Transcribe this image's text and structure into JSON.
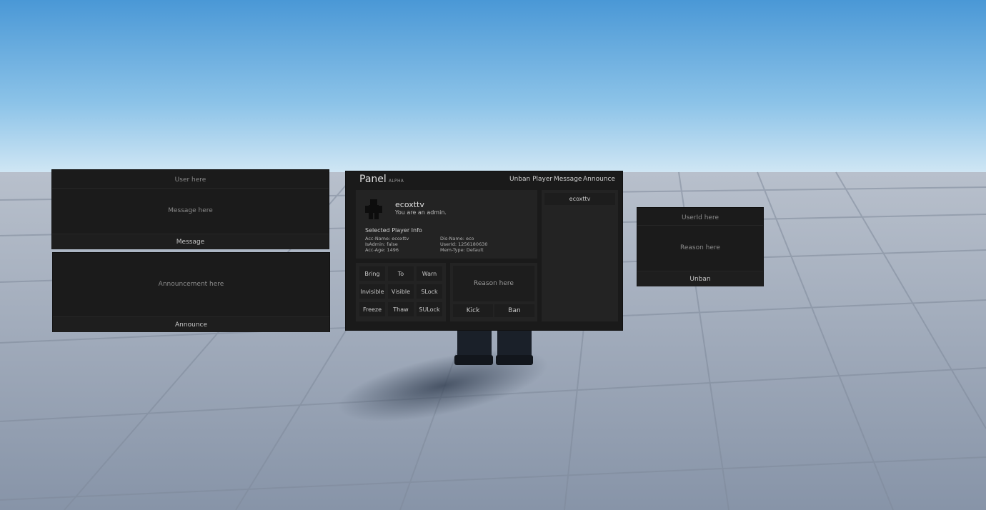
{
  "message_panel": {
    "user_placeholder": "User here",
    "message_placeholder": "Message here",
    "send_label": "Message"
  },
  "announce_panel": {
    "announcement_placeholder": "Announcement here",
    "send_label": "Announce"
  },
  "main_panel": {
    "title": "Panel",
    "badge": "ALPHA",
    "nav": [
      "Unban Player",
      "Message",
      "Announce"
    ],
    "player": {
      "name": "ecoxttv",
      "status": "You are an admin.",
      "info_heading": "Selected Player Info",
      "info_left": [
        "Acc-Name: ecoxttv",
        "IsAdmin: false",
        "Acc-Age: 1496"
      ],
      "info_right": [
        "Dis-Name: eco",
        "UserId: 1256180630",
        "Mem-Type: Default"
      ]
    },
    "actions": [
      "Bring",
      "To",
      "Warn",
      "Invisible",
      "Visible",
      "SLock",
      "Freeze",
      "Thaw",
      "SULock"
    ],
    "reason_placeholder": "Reason here",
    "kick_label": "Kick",
    "ban_label": "Ban",
    "player_list": [
      "ecoxttv"
    ]
  },
  "unban_panel": {
    "userid_placeholder": "UserId here",
    "reason_placeholder": "Reason here",
    "unban_label": "Unban"
  },
  "colors": {
    "sky_top": "#4a9ad8",
    "sky_bottom": "#c5e0f2",
    "floor": "#9aa6b8",
    "panel_bg": "#1b1b1b",
    "cell_bg": "#232323"
  }
}
